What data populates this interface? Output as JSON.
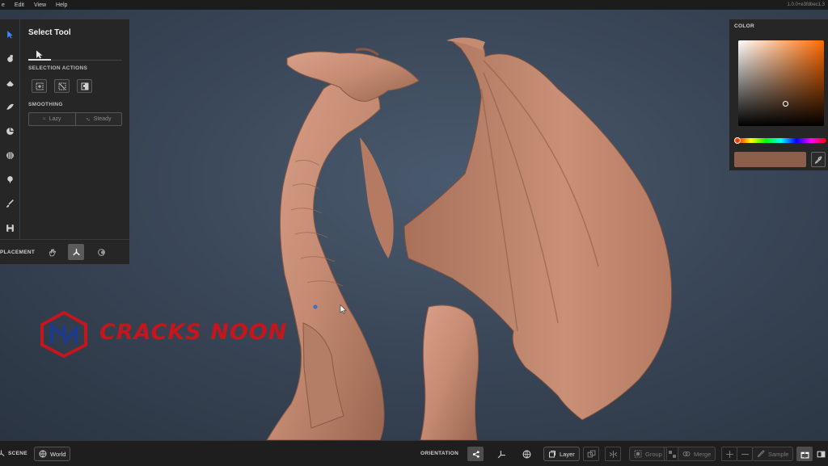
{
  "menubar": {
    "items": [
      "e",
      "Edit",
      "View",
      "Help"
    ],
    "version": "1.0.0+e3fdbec1.3"
  },
  "toolbar": {
    "icons": [
      "select-arrow",
      "paint-brush-blob",
      "eraser",
      "smooth-brush",
      "clay-brush",
      "inflate-brush",
      "pin-brush",
      "paint-brush",
      "save-disk"
    ]
  },
  "tool_panel": {
    "title": "Select Tool",
    "selection_actions_label": "SELECTION ACTIONS",
    "smoothing_label": "SMOOTHING",
    "smoothing_options": [
      "Lazy",
      "Steady"
    ]
  },
  "placement": {
    "label": "PLACEMENT"
  },
  "color_panel": {
    "title": "COLOR",
    "current_color": "#8c5e4c"
  },
  "bottombar": {
    "scene_label": "SCENE",
    "world_label": "World",
    "orientation_label": "ORIENTATION",
    "layer_label": "Layer",
    "group_label": "Group",
    "merge_label": "Merge",
    "sample_label": "Sample"
  },
  "watermark": {
    "text": "CRACKS NOON",
    "color": "#c4161c",
    "accent": "#1c3a8f"
  },
  "colors": {
    "accent_blue": "#3d8cff",
    "model_clay": "#c48a72"
  }
}
